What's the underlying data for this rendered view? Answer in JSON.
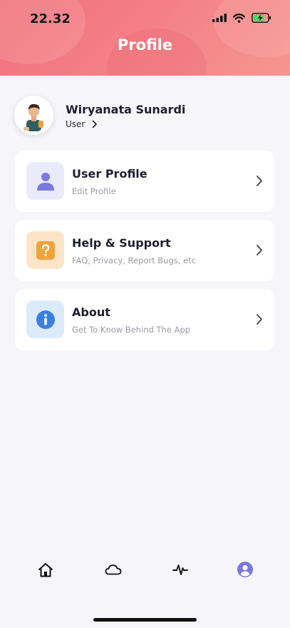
{
  "status_bar": {
    "time": "22.32"
  },
  "header": {
    "title": "Profile"
  },
  "profile": {
    "name": "Wiryanata Sunardi",
    "role": "User"
  },
  "menu": [
    {
      "title": "User Profile",
      "subtitle": "Edit Profile",
      "icon": "user-icon",
      "icon_bg": "#ebeafb",
      "icon_color": "#7c78e0"
    },
    {
      "title": "Help & Support",
      "subtitle": "FAQ, Privacy, Report Bugs, etc",
      "icon": "question-icon",
      "icon_bg": "#fce5c7",
      "icon_color": "#f0a33a"
    },
    {
      "title": "About",
      "subtitle": "Get To Know Behind The App",
      "icon": "info-icon",
      "icon_bg": "#dcebfb",
      "icon_color": "#3b7fe0"
    }
  ],
  "bottom_nav": [
    {
      "icon": "home-icon"
    },
    {
      "icon": "cloud-icon"
    },
    {
      "icon": "activity-icon"
    },
    {
      "icon": "account-icon",
      "active": true,
      "active_color": "#7c78e0"
    }
  ]
}
